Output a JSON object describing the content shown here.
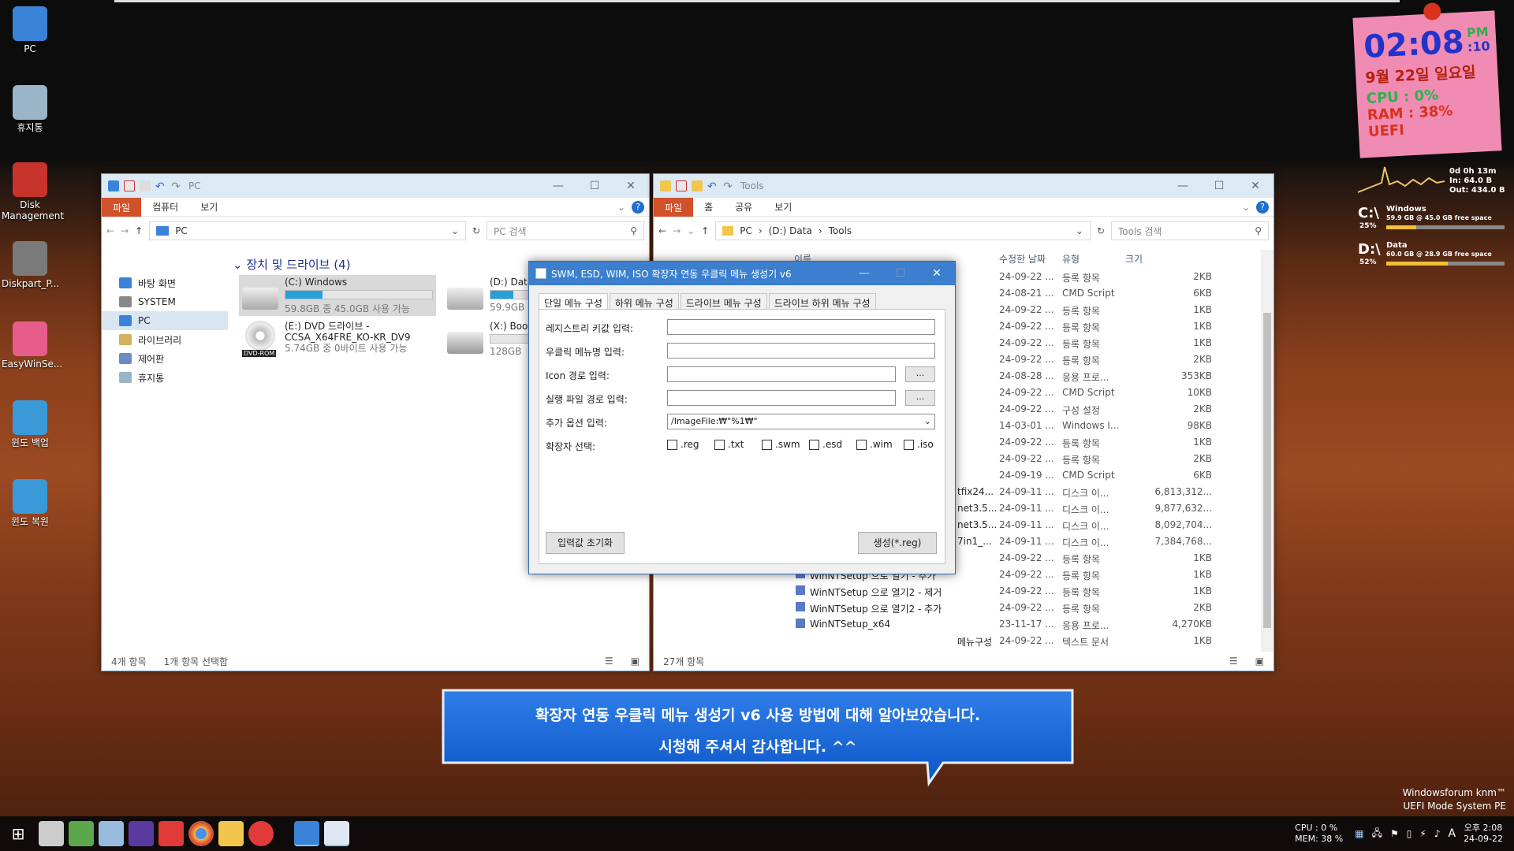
{
  "desktop": {
    "icons": [
      {
        "label": "PC",
        "icon": "pc-icon",
        "color": "#3a83d8"
      },
      {
        "label": "휴지통",
        "icon": "recycle-bin-icon",
        "color": "#9ab4c8"
      },
      {
        "label": "Disk Management",
        "icon": "disk-management-icon",
        "color": "#c8332c"
      },
      {
        "label": "Diskpart_P...",
        "icon": "diskpart-icon",
        "color": "#7a7a7a"
      },
      {
        "label": "EasyWinSe...",
        "icon": "easywinsetup-icon",
        "color": "#e85c8c"
      },
      {
        "label": "윈도 백업",
        "icon": "backup-icon",
        "color": "#3a9ad8"
      },
      {
        "label": "윈도 복원",
        "icon": "restore-icon",
        "color": "#3a9ad8"
      }
    ]
  },
  "clock_widget": {
    "time": "02:08",
    "seconds": ":10",
    "ampm": "PM",
    "date": "9월 22일 일요일",
    "cpu": "CPU : 0%",
    "ram": "RAM : 38%",
    "firmware": "UEFI"
  },
  "sysmon": {
    "uptime": "0d 0h 13m",
    "net_in": "In: 64.0 B",
    "net_out": "Out: 434.0 B",
    "drives": [
      {
        "letter": "C:\\",
        "name": "Windows",
        "detail": "59.9 GB @ 45.0 GB free space",
        "pct_label": "25%",
        "used": 0.25
      },
      {
        "letter": "D:\\",
        "name": "Data",
        "detail": "60.0 GB @ 28.9 GB free space",
        "pct_label": "52%",
        "used": 0.52
      }
    ]
  },
  "explorer_pc": {
    "title": "PC",
    "ribbon": {
      "file": "파일",
      "tabs": [
        "컴퓨터",
        "보기"
      ]
    },
    "address": "PC",
    "search_placeholder": "PC 검색",
    "nav": [
      "바탕 화면",
      "SYSTEM",
      "PC",
      "라이브러리",
      "제어판",
      "휴지통"
    ],
    "group_title": "장치 및 드라이브 (4)",
    "drives": [
      {
        "name": "(C:) Windows",
        "detail": "59.8GB 중 45.0GB 사용 가능",
        "used": 0.25
      },
      {
        "name": "(D:) Data",
        "detail": "59.9GB",
        "used": 0.52
      },
      {
        "name": "(E:) DVD 드라이브 -",
        "name2": "CCSA_X64FRE_KO-KR_DV9",
        "detail": "5.74GB 중 0바이트 사용 가능",
        "badge": "DVD-ROM"
      },
      {
        "name": "(X:) Boot",
        "detail": "128GB"
      }
    ],
    "status_items": "4개 항목",
    "status_selected": "1개 항목 선택함"
  },
  "explorer_tools": {
    "title": "Tools",
    "ribbon": {
      "file": "파일",
      "tabs": [
        "홈",
        "공유",
        "보기"
      ]
    },
    "breadcrumb": [
      "PC",
      "(D:) Data",
      "Tools"
    ],
    "search_placeholder": "Tools 검색",
    "columns": {
      "name": "이름",
      "date": "수정한 날짜",
      "type": "유형",
      "size": "크기"
    },
    "rows": [
      {
        "name": "",
        "date": "24-09-22 ...",
        "type": "등록 항목",
        "size": "2KB"
      },
      {
        "name": "",
        "date": "24-08-21 ...",
        "type": "CMD Script",
        "size": "6KB"
      },
      {
        "name": "",
        "date": "24-09-22 ...",
        "type": "등록 항목",
        "size": "1KB"
      },
      {
        "name": "",
        "date": "24-09-22 ...",
        "type": "등록 항목",
        "size": "1KB"
      },
      {
        "name": "",
        "date": "24-09-22 ...",
        "type": "등록 항목",
        "size": "1KB"
      },
      {
        "name": "",
        "date": "24-09-22 ...",
        "type": "등록 항목",
        "size": "2KB"
      },
      {
        "name": "",
        "date": "24-08-28 ...",
        "type": "응용 프로...",
        "size": "353KB"
      },
      {
        "name": "",
        "date": "24-09-22 ...",
        "type": "CMD Script",
        "size": "10KB"
      },
      {
        "name": "",
        "date": "24-09-22 ...",
        "type": "구성 설정",
        "size": "2KB"
      },
      {
        "name": "",
        "date": "14-03-01 ...",
        "type": "Windows I...",
        "size": "98KB"
      },
      {
        "name": "",
        "date": "24-09-22 ...",
        "type": "등록 항목",
        "size": "1KB"
      },
      {
        "name": "",
        "date": "24-09-22 ...",
        "type": "등록 항목",
        "size": "2KB"
      },
      {
        "name": "",
        "date": "24-09-19 ...",
        "type": "CMD Script",
        "size": "6KB"
      },
      {
        "name": "tfix24...",
        "date": "24-09-11 ...",
        "type": "디스크 이...",
        "size": "6,813,312..."
      },
      {
        "name": "net3.5...",
        "date": "24-09-11 ...",
        "type": "디스크 이...",
        "size": "9,877,632..."
      },
      {
        "name": "net3.5...",
        "date": "24-09-11 ...",
        "type": "디스크 이...",
        "size": "8,092,704..."
      },
      {
        "name": "7in1_...",
        "date": "24-09-11 ...",
        "type": "디스크 이...",
        "size": "7,384,768..."
      },
      {
        "name": "",
        "date": "24-09-22 ...",
        "type": "등록 항목",
        "size": "1KB"
      },
      {
        "name": "WinNTSetup 으로 열기 - 추가",
        "date": "24-09-22 ...",
        "type": "등록 항목",
        "size": "1KB"
      },
      {
        "name": "WinNTSetup 으로 열기2 - 제거",
        "date": "24-09-22 ...",
        "type": "등록 항목",
        "size": "1KB"
      },
      {
        "name": "WinNTSetup 으로 열기2 - 추가",
        "date": "24-09-22 ...",
        "type": "등록 항목",
        "size": "2KB"
      },
      {
        "name": "WinNTSetup_x64",
        "date": "23-11-17 ...",
        "type": "응용 프로...",
        "size": "4,270KB"
      },
      {
        "name": "메뉴구성",
        "date": "24-09-22 ...",
        "type": "텍스트 문서",
        "size": "1KB"
      }
    ],
    "status_items": "27개 항목"
  },
  "dialog": {
    "title": "SWM, ESD, WIM, ISO 확장자 연동 우클릭 메뉴 생성기 v6",
    "tabs": [
      "단일 메뉴 구성",
      "하위 메뉴 구성",
      "드라이브 메뉴 구성",
      "드라이브 하위 메뉴 구성"
    ],
    "labels": {
      "reg_key": "레지스트리 키값 입력:",
      "menu_name": "우클릭 메뉴명 입력:",
      "icon_path": "Icon 경로 입력:",
      "exe_path": "실행 파일 경로 입력:",
      "options": "추가 옵션 입력:",
      "ext": "확장자 선택:"
    },
    "values": {
      "reg_key": "",
      "menu_name": "",
      "icon_path": "",
      "exe_path": "",
      "options": "/ImageFile:₩\"%1₩\""
    },
    "browse": "...",
    "extensions": [
      ".reg",
      ".txt",
      ".swm",
      ".esd",
      ".wim",
      ".iso"
    ],
    "reset_button": "입력값 초기화",
    "create_button": "생성(*.reg)"
  },
  "callout": {
    "line1": "확장자 연동 우클릭 메뉴 생성기 v6 사용 방법에 대해 알아보았습니다.",
    "line2": "시청해 주셔서 감사합니다. ^^"
  },
  "watermark": {
    "line1": "Windowsforum knm™",
    "line2": "UEFI Mode System PE"
  },
  "taskbar": {
    "cpu": "CPU :   0 %",
    "mem": "MEM:  38 %",
    "time": "오후 2:08",
    "date": "24-09-22",
    "ime": "A"
  }
}
